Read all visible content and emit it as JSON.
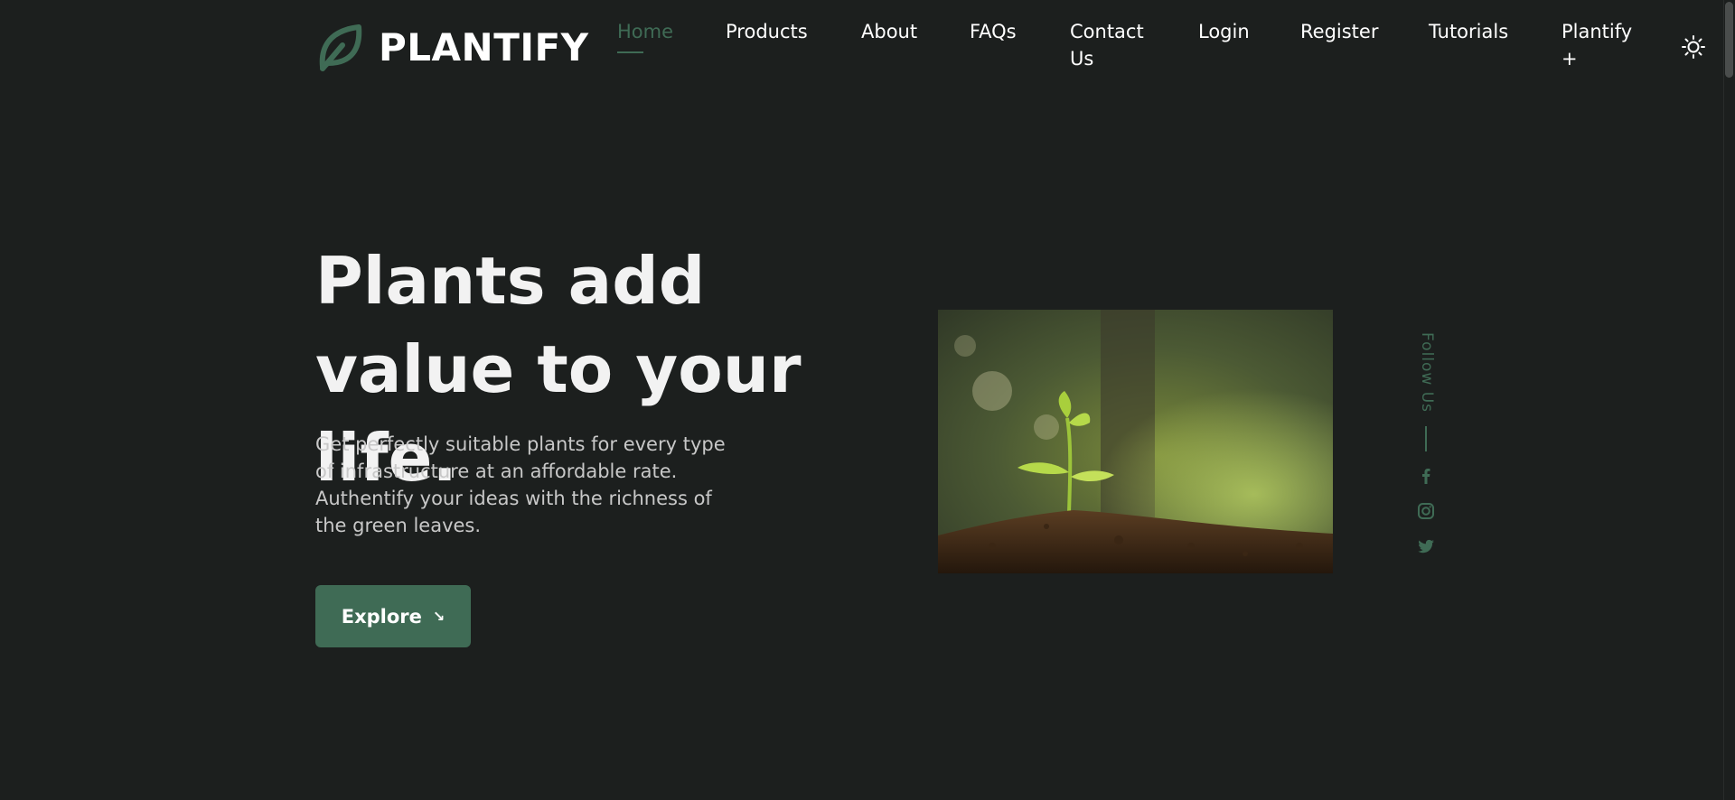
{
  "header": {
    "brand": "PLANTIFY",
    "nav": [
      {
        "label": "Home",
        "active": true
      },
      {
        "label": "Products"
      },
      {
        "label": "About"
      },
      {
        "label": "FAQs"
      },
      {
        "label": "Contact Us"
      },
      {
        "label": "Login"
      },
      {
        "label": "Register"
      },
      {
        "label": "Tutorials"
      },
      {
        "label": "Plantify +"
      }
    ],
    "theme_icon": "sun-icon"
  },
  "hero": {
    "title": "Plants add value to your life.",
    "description": "Get perfectly suitable plants for every type of infrastructure at an affordable rate. Authentify your ideas with the richness of the green leaves.",
    "cta_label": "Explore",
    "cta_icon": "arrow-down-right-icon",
    "image_alt": "seedling"
  },
  "follow": {
    "label": "Follow Us",
    "icons": [
      "facebook-icon",
      "instagram-icon",
      "twitter-icon"
    ]
  },
  "colors": {
    "background": "#1c1f1e",
    "accent": "#3f6b55",
    "text": "#ffffff"
  }
}
